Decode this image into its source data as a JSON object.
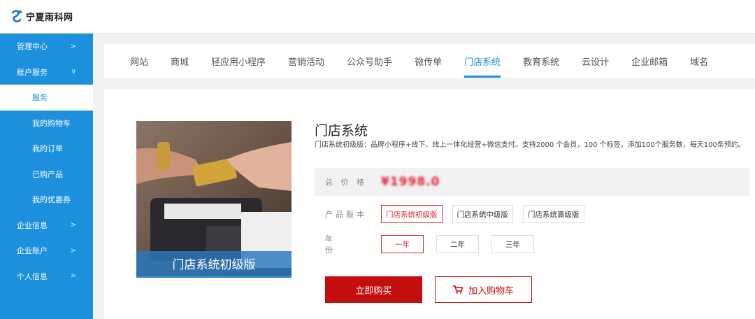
{
  "brand": {
    "name": "宁夏雨科网"
  },
  "sidebar": {
    "items": [
      {
        "label": "管理中心",
        "arrow": ">"
      },
      {
        "label": "账户服务",
        "arrow": "∨"
      },
      {
        "label": "服务"
      },
      {
        "label": "我的购物车"
      },
      {
        "label": "我的订单"
      },
      {
        "label": "已购产品"
      },
      {
        "label": "我的优惠券"
      },
      {
        "label": "企业信息",
        "arrow": ">"
      },
      {
        "label": "企业账户",
        "arrow": ">"
      },
      {
        "label": "个人信息",
        "arrow": ">"
      }
    ]
  },
  "tabs": [
    "网站",
    "商城",
    "轻应用小程序",
    "营销活动",
    "公众号助手",
    "微传单",
    "门店系统",
    "教育系统",
    "云设计",
    "企业邮箱",
    "域名"
  ],
  "product": {
    "image_caption": "门店系统初级版",
    "title": "门店系统",
    "description": "门店系统初级版：品牌小程序+线下、线上一体化经营+微信支付。支持2000 个会员，100 个标签，添加100个服务数，每天100条预约。",
    "price_label": "总 价 格",
    "price": "¥1998.0",
    "version_label": "产品版本",
    "versions": [
      "门店系统初级版",
      "门店系统中级版",
      "门店系统高级版"
    ],
    "year_label": "年 份",
    "years": [
      "一年",
      "二年",
      "三年"
    ]
  },
  "actions": {
    "buy": "立即购买",
    "cart": "加入购物车"
  },
  "colors": {
    "sidebar": "#1d90dd",
    "accent": "#1d90dd",
    "buy": "#c40d0d",
    "price": "#e0253a"
  },
  "icons": {
    "logo": "brand-logo-icon",
    "cart": "cart-icon"
  }
}
